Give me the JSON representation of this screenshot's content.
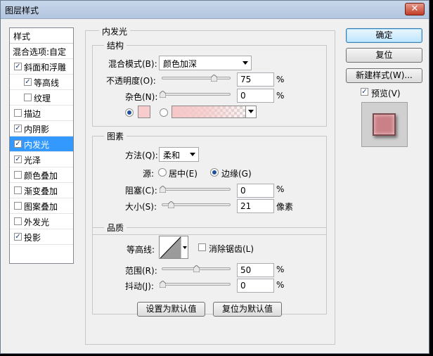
{
  "window": {
    "title": "图层样式",
    "close": "✕"
  },
  "stylelist": {
    "header": "样式",
    "blend": "混合选项:自定",
    "items": [
      {
        "label": "斜面和浮雕",
        "checked": true
      },
      {
        "label": "等高线",
        "checked": true
      },
      {
        "label": "纹理",
        "checked": false
      },
      {
        "label": "描边",
        "checked": false
      },
      {
        "label": "内阴影",
        "checked": true
      },
      {
        "label": "内发光",
        "checked": true,
        "selected": true
      },
      {
        "label": "光泽",
        "checked": true
      },
      {
        "label": "颜色叠加",
        "checked": false
      },
      {
        "label": "渐变叠加",
        "checked": false
      },
      {
        "label": "图案叠加",
        "checked": false
      },
      {
        "label": "外发光",
        "checked": false
      },
      {
        "label": "投影",
        "checked": true
      }
    ]
  },
  "panel": {
    "title": "内发光",
    "structure": {
      "title": "结构",
      "blend_mode_label": "混合模式(B):",
      "blend_mode_value": "颜色加深",
      "opacity_label": "不透明度(O):",
      "opacity_value": "75",
      "noise_label": "杂色(N):",
      "noise_value": "0",
      "unit": "%",
      "color_swatch": "#f8cccc",
      "gradient_from": "#f6c7c7"
    },
    "elements": {
      "title": "图素",
      "method_label": "方法(Q):",
      "method_value": "柔和",
      "source_label": "源:",
      "source_center": "居中(E)",
      "source_edge": "边缘(G)",
      "choke_label": "阻塞(C):",
      "choke_value": "0",
      "size_label": "大小(S):",
      "size_value": "21",
      "size_unit": "像素",
      "unit": "%"
    },
    "quality": {
      "title": "品质",
      "contour_label": "等高线:",
      "antialias_label": "消除锯齿(L)",
      "range_label": "范围(R):",
      "range_value": "50",
      "jitter_label": "抖动(J):",
      "jitter_value": "0",
      "unit": "%"
    },
    "set_default": "设置为默认值",
    "reset_default": "复位为默认值"
  },
  "buttons": {
    "ok": "确定",
    "reset": "复位",
    "new_style": "新建样式(W)...",
    "preview_label": "预览(V)",
    "preview_checked": true
  },
  "colors": {
    "accent": "#3399ff",
    "preview": "#c98087"
  }
}
